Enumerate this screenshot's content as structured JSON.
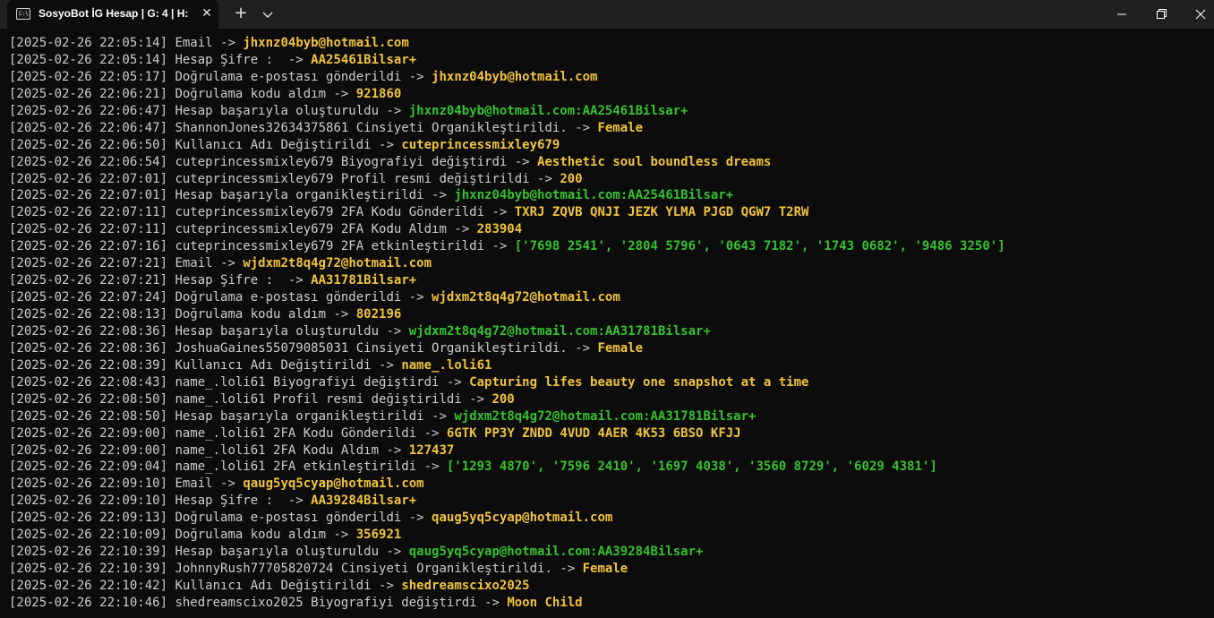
{
  "titlebar": {
    "tab_title": "SosyoBot İG Hesap | G: 4 | H:",
    "tab_icon": "terminal-icon",
    "close_icon": "close-icon",
    "new_tab_icon": "plus-icon",
    "dropdown_icon": "chevron-down-icon",
    "window_controls": [
      "minimize-icon",
      "maximize-icon",
      "close-icon"
    ]
  },
  "colors": {
    "background": "#0c0c0c",
    "text": "#cccccc",
    "yellow": "#f0c33c",
    "green": "#35c12f",
    "titlebar": "#202020"
  },
  "terminal": {
    "lines": [
      {
        "time": "[2025-02-26 22:05:14]",
        "msg": " Email -> ",
        "val": "jhxnz04byb@hotmail.com",
        "color": "yellow"
      },
      {
        "time": "[2025-02-26 22:05:14]",
        "msg": " Hesap Şifre :  -> ",
        "val": "AA25461Bilsar+",
        "color": "yellow"
      },
      {
        "time": "[2025-02-26 22:05:17]",
        "msg": " Doğrulama e-postası gönderildi -> ",
        "val": "jhxnz04byb@hotmail.com",
        "color": "yellow"
      },
      {
        "time": "[2025-02-26 22:06:21]",
        "msg": " Doğrulama kodu aldım -> ",
        "val": "921860",
        "color": "yellow"
      },
      {
        "time": "[2025-02-26 22:06:47]",
        "msg": " Hesap başarıyla oluşturuldu -> ",
        "val": "jhxnz04byb@hotmail.com:AA25461Bilsar+",
        "color": "green"
      },
      {
        "time": "[2025-02-26 22:06:47]",
        "msg": " ShannonJones32634375861 Cinsiyeti Organikleştirildi. -> ",
        "val": "Female",
        "color": "yellow"
      },
      {
        "time": "[2025-02-26 22:06:50]",
        "msg": " Kullanıcı Adı Değiştirildi -> ",
        "val": "cuteprincessmixley679",
        "color": "yellow"
      },
      {
        "time": "[2025-02-26 22:06:54]",
        "msg": " cuteprincessmixley679 Biyografiyi değiştirdi -> ",
        "val": "Aesthetic soul boundless dreams",
        "color": "yellow"
      },
      {
        "time": "[2025-02-26 22:07:01]",
        "msg": " cuteprincessmixley679 Profil resmi değiştirildi -> ",
        "val": "200",
        "color": "yellow"
      },
      {
        "time": "[2025-02-26 22:07:01]",
        "msg": " Hesap başarıyla organikleştirildi -> ",
        "val": "jhxnz04byb@hotmail.com:AA25461Bilsar+",
        "color": "green"
      },
      {
        "time": "[2025-02-26 22:07:11]",
        "msg": " cuteprincessmixley679 2FA Kodu Gönderildi -> ",
        "val": "TXRJ ZQVB QNJI JEZK YLMA PJGD QGW7 T2RW",
        "color": "yellow"
      },
      {
        "time": "[2025-02-26 22:07:11]",
        "msg": " cuteprincessmixley679 2FA Kodu Aldım -> ",
        "val": "283904",
        "color": "yellow"
      },
      {
        "time": "[2025-02-26 22:07:16]",
        "msg": " cuteprincessmixley679 2FA etkinleştirildi -> ",
        "val": "['7698 2541', '2804 5796', '0643 7182', '1743 0682', '9486 3250']",
        "color": "green"
      },
      {
        "time": "[2025-02-26 22:07:21]",
        "msg": " Email -> ",
        "val": "wjdxm2t8q4g72@hotmail.com",
        "color": "yellow"
      },
      {
        "time": "[2025-02-26 22:07:21]",
        "msg": " Hesap Şifre :  -> ",
        "val": "AA31781Bilsar+",
        "color": "yellow"
      },
      {
        "time": "[2025-02-26 22:07:24]",
        "msg": " Doğrulama e-postası gönderildi -> ",
        "val": "wjdxm2t8q4g72@hotmail.com",
        "color": "yellow"
      },
      {
        "time": "[2025-02-26 22:08:13]",
        "msg": " Doğrulama kodu aldım -> ",
        "val": "802196",
        "color": "yellow"
      },
      {
        "time": "[2025-02-26 22:08:36]",
        "msg": " Hesap başarıyla oluşturuldu -> ",
        "val": "wjdxm2t8q4g72@hotmail.com:AA31781Bilsar+",
        "color": "green"
      },
      {
        "time": "[2025-02-26 22:08:36]",
        "msg": " JoshuaGaines55079085031 Cinsiyeti Organikleştirildi. -> ",
        "val": "Female",
        "color": "yellow"
      },
      {
        "time": "[2025-02-26 22:08:39]",
        "msg": " Kullanıcı Adı Değiştirildi -> ",
        "val": "name_.loli61",
        "color": "yellow"
      },
      {
        "time": "[2025-02-26 22:08:43]",
        "msg": " name_.loli61 Biyografiyi değiştirdi -> ",
        "val": "Capturing lifes beauty one snapshot at a time",
        "color": "yellow"
      },
      {
        "time": "[2025-02-26 22:08:50]",
        "msg": " name_.loli61 Profil resmi değiştirildi -> ",
        "val": "200",
        "color": "yellow"
      },
      {
        "time": "[2025-02-26 22:08:50]",
        "msg": " Hesap başarıyla organikleştirildi -> ",
        "val": "wjdxm2t8q4g72@hotmail.com:AA31781Bilsar+",
        "color": "green"
      },
      {
        "time": "[2025-02-26 22:09:00]",
        "msg": " name_.loli61 2FA Kodu Gönderildi -> ",
        "val": "6GTK PP3Y ZNDD 4VUD 4AER 4K53 6BSO KFJJ",
        "color": "yellow"
      },
      {
        "time": "[2025-02-26 22:09:00]",
        "msg": " name_.loli61 2FA Kodu Aldım -> ",
        "val": "127437",
        "color": "yellow"
      },
      {
        "time": "[2025-02-26 22:09:04]",
        "msg": " name_.loli61 2FA etkinleştirildi -> ",
        "val": "['1293 4870', '7596 2410', '1697 4038', '3560 8729', '6029 4381']",
        "color": "green"
      },
      {
        "time": "[2025-02-26 22:09:10]",
        "msg": " Email -> ",
        "val": "qaug5yq5cyap@hotmail.com",
        "color": "yellow"
      },
      {
        "time": "[2025-02-26 22:09:10]",
        "msg": " Hesap Şifre :  -> ",
        "val": "AA39284Bilsar+",
        "color": "yellow"
      },
      {
        "time": "[2025-02-26 22:09:13]",
        "msg": " Doğrulama e-postası gönderildi -> ",
        "val": "qaug5yq5cyap@hotmail.com",
        "color": "yellow"
      },
      {
        "time": "[2025-02-26 22:10:09]",
        "msg": " Doğrulama kodu aldım -> ",
        "val": "356921",
        "color": "yellow"
      },
      {
        "time": "[2025-02-26 22:10:39]",
        "msg": " Hesap başarıyla oluşturuldu -> ",
        "val": "qaug5yq5cyap@hotmail.com:AA39284Bilsar+",
        "color": "green"
      },
      {
        "time": "[2025-02-26 22:10:39]",
        "msg": " JohnnyRush77705820724 Cinsiyeti Organikleştirildi. -> ",
        "val": "Female",
        "color": "yellow"
      },
      {
        "time": "[2025-02-26 22:10:42]",
        "msg": " Kullanıcı Adı Değiştirildi -> ",
        "val": "shedreamscixo2025",
        "color": "yellow"
      },
      {
        "time": "[2025-02-26 22:10:46]",
        "msg": " shedreamscixo2025 Biyografiyi değiştirdi -> ",
        "val": "Moon Child",
        "color": "yellow"
      }
    ]
  }
}
